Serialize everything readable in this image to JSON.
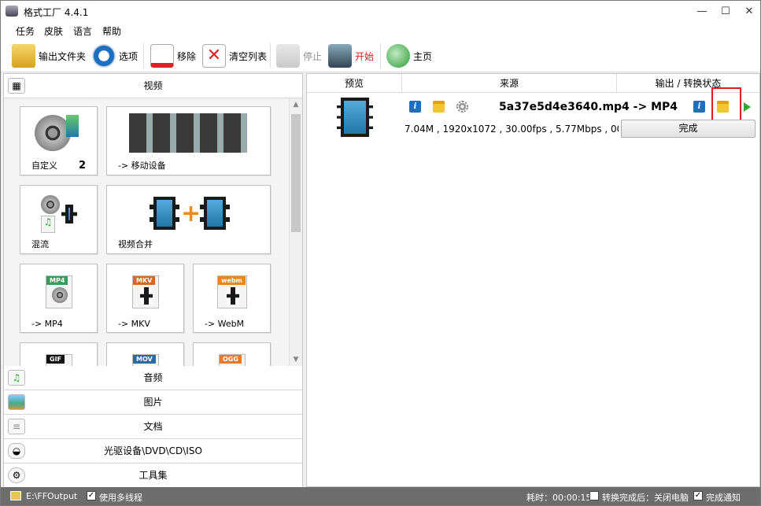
{
  "window": {
    "title": "格式工厂 4.4.1",
    "controls": [
      "—",
      "☐",
      "✕"
    ]
  },
  "menu": [
    "任务",
    "皮肤",
    "语言",
    "帮助"
  ],
  "toolbar": {
    "output_folder": "输出文件夹",
    "options": "选项",
    "remove": "移除",
    "clear_list": "清空列表",
    "stop": "停止",
    "start": "开始",
    "home": "主页"
  },
  "left": {
    "video_header": "视频",
    "tiles": {
      "custom": "自定义",
      "custom_count": "2",
      "mobile": "-> 移动设备",
      "mux": "混流",
      "join": "视频合并",
      "mp4": "-> MP4",
      "mkv": "-> MKV",
      "webm": "-> WebM"
    },
    "tags": {
      "mp4": "MP4",
      "mkv": "MKV",
      "webm": "webm",
      "gif": "GIF",
      "mov": "MOV",
      "ogg": "OGG"
    },
    "categories": [
      "音频",
      "图片",
      "文档",
      "光驱设备\\DVD\\CD\\ISO",
      "工具集"
    ]
  },
  "task": {
    "columns": [
      "预览",
      "来源",
      "输出 / 转换状态"
    ],
    "filename": "5a37e5d4e3640.mp4 -> MP4",
    "meta": "7.04M , 1920x1072 , 30.00fps , 5.77Mbps , 00:0",
    "status_button": "完成"
  },
  "status": {
    "path": "E:\\FFOutput",
    "multithread": "使用多线程",
    "elapsed": "耗时：00:00:15",
    "after": "转换完成后：关闭电脑",
    "notify": "完成通知"
  }
}
